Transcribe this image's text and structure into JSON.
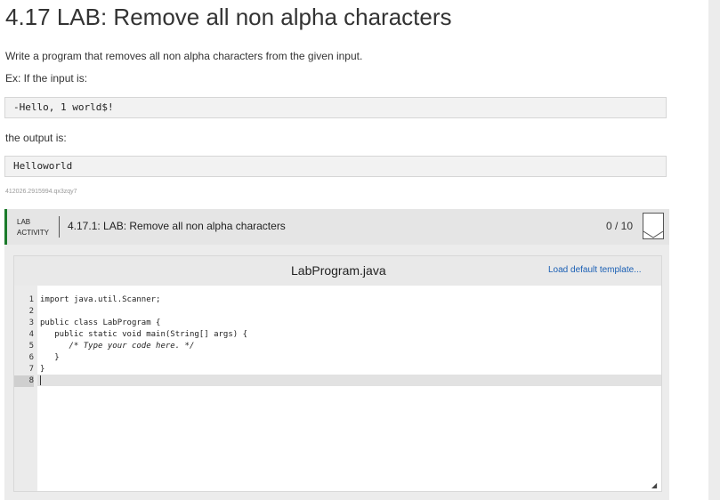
{
  "page": {
    "title": "4.17 LAB: Remove all non alpha characters",
    "description": "Write a program that removes all non alpha characters from the given input.",
    "example_intro": "Ex: If the input is:",
    "example_input": "-Hello, 1 world$!",
    "output_intro": "the output is:",
    "example_output": "Helloworld",
    "activity_id": "412026.2915994.qx3zqy7"
  },
  "lab": {
    "tag_line1": "LAB",
    "tag_line2": "ACTIVITY",
    "title": "4.17.1: LAB: Remove all non alpha characters",
    "score": "0 / 10"
  },
  "editor": {
    "file_name": "LabProgram.java",
    "load_template_label": "Load default template...",
    "line_numbers": [
      "1",
      "2",
      "3",
      "4",
      "5",
      "6",
      "7",
      "8"
    ],
    "lines": [
      "import java.util.Scanner;",
      "",
      "public class LabProgram {",
      "   public static void main(String[] args) {",
      "      /* Type your code here. */",
      "   }",
      "}",
      ""
    ]
  }
}
